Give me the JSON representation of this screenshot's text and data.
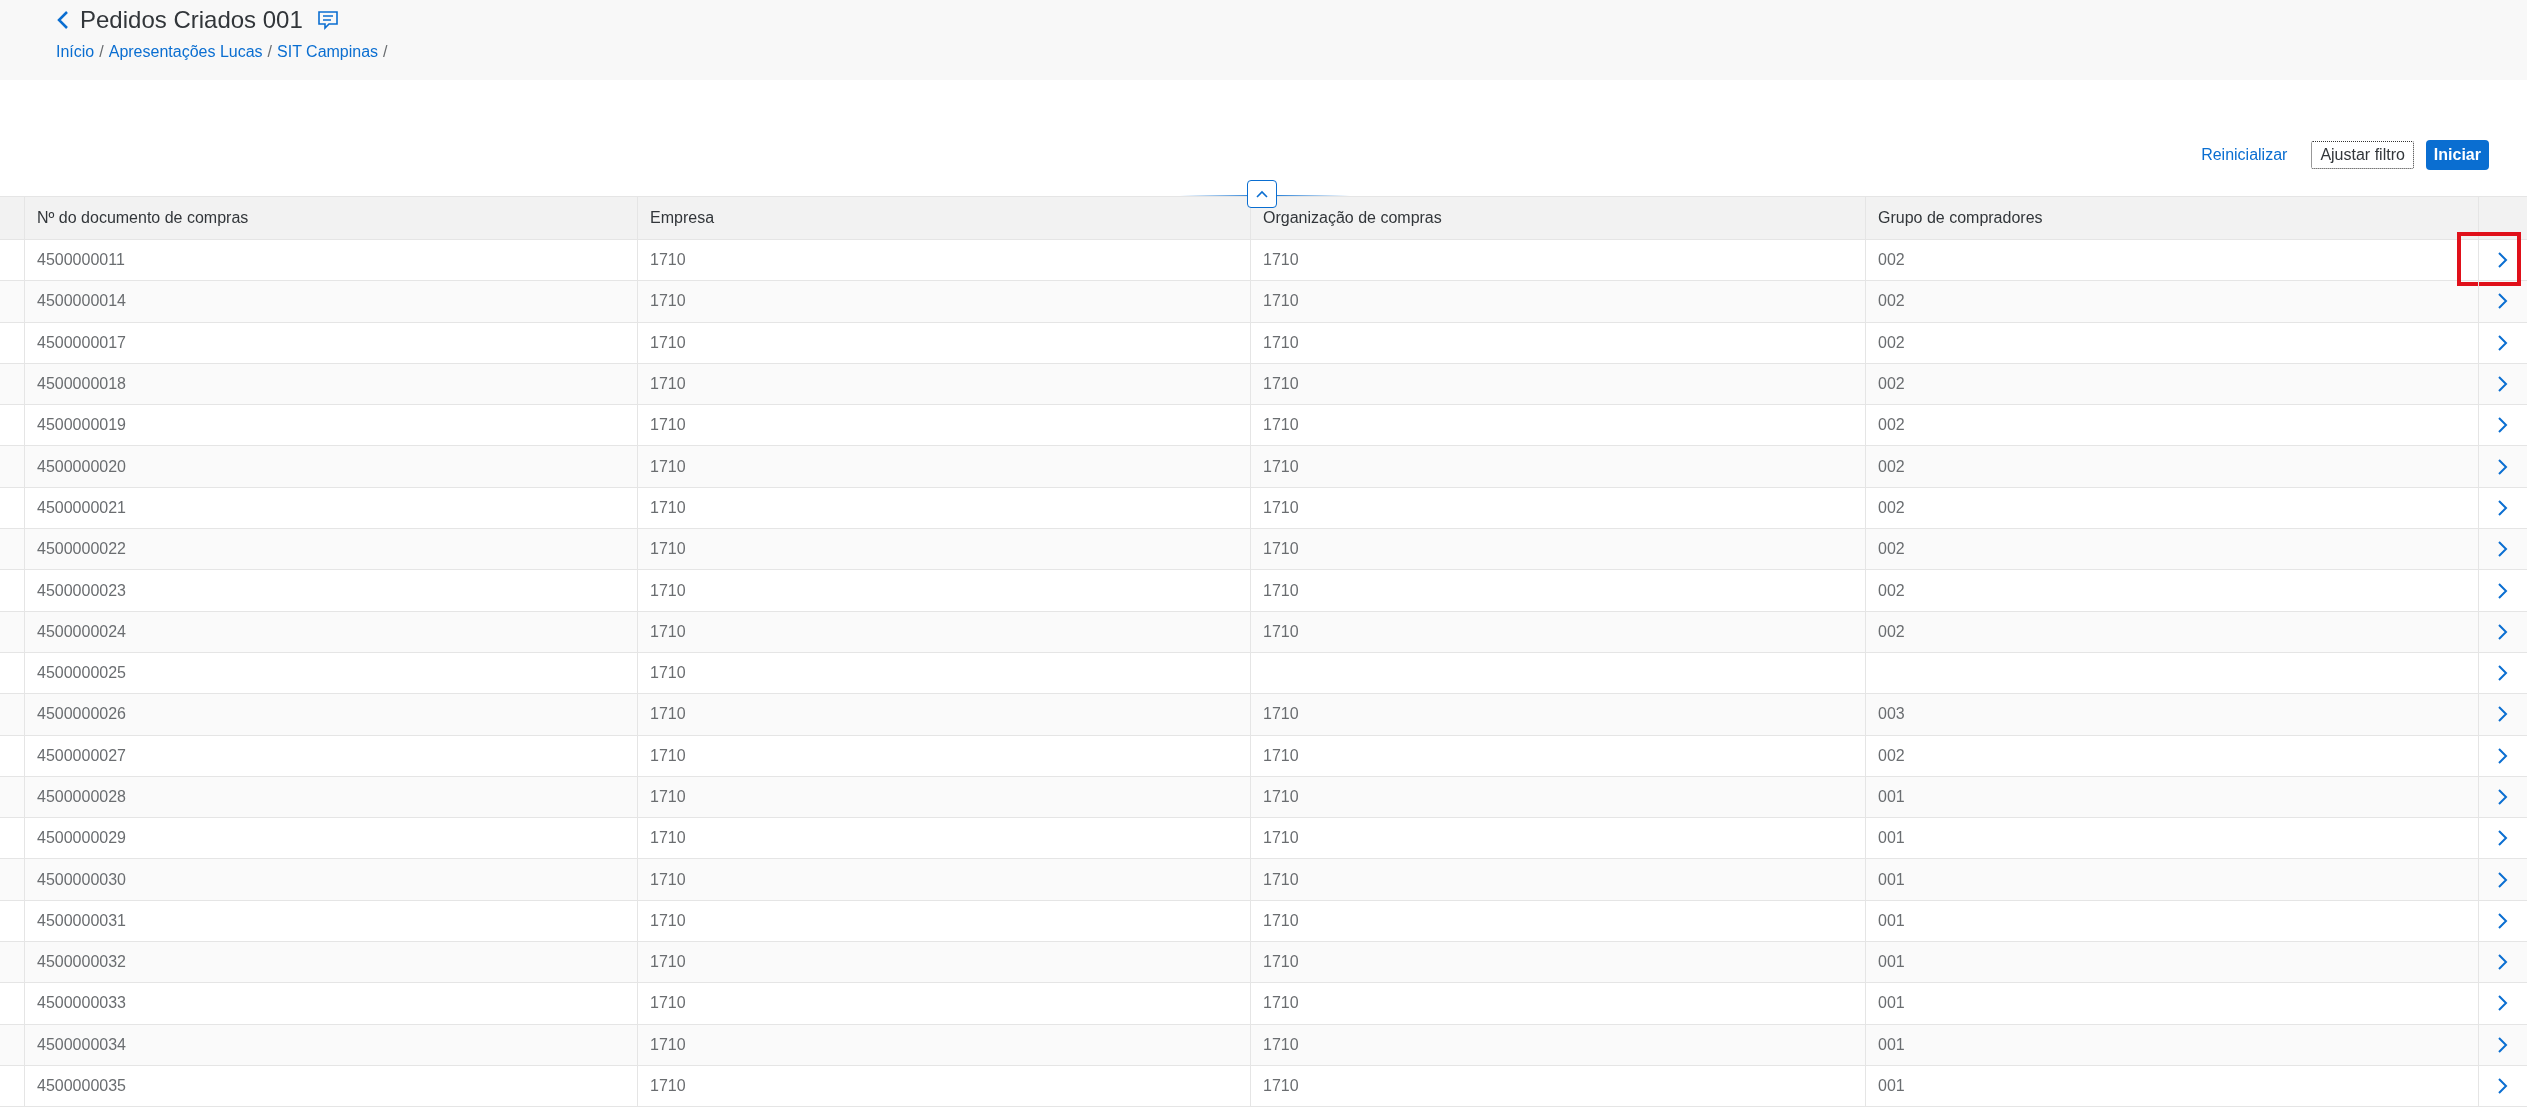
{
  "header": {
    "title": "Pedidos Criados 001",
    "breadcrumbs": [
      {
        "label": "Início",
        "separator": "/"
      },
      {
        "label": "Apresentações Lucas",
        "separator": "/"
      },
      {
        "label": "SIT Campinas",
        "separator": "/"
      }
    ]
  },
  "filter_bar": {
    "buttons": [
      {
        "label": "Reinicializar",
        "kind": "link"
      },
      {
        "label": "Ajustar filtro",
        "kind": "outline"
      },
      {
        "label": "Iniciar",
        "kind": "primary"
      }
    ]
  },
  "table": {
    "columns": [
      "Nº do documento de compras",
      "Empresa",
      "Organização de compras",
      "Grupo de compradores"
    ],
    "rows": [
      {
        "cells": [
          "4500000011",
          "1710",
          "1710",
          "002"
        ],
        "highlighted": true
      },
      {
        "cells": [
          "4500000014",
          "1710",
          "1710",
          "002"
        ],
        "highlighted": false
      },
      {
        "cells": [
          "4500000017",
          "1710",
          "1710",
          "002"
        ],
        "highlighted": false
      },
      {
        "cells": [
          "4500000018",
          "1710",
          "1710",
          "002"
        ],
        "highlighted": false
      },
      {
        "cells": [
          "4500000019",
          "1710",
          "1710",
          "002"
        ],
        "highlighted": false
      },
      {
        "cells": [
          "4500000020",
          "1710",
          "1710",
          "002"
        ],
        "highlighted": false
      },
      {
        "cells": [
          "4500000021",
          "1710",
          "1710",
          "002"
        ],
        "highlighted": false
      },
      {
        "cells": [
          "4500000022",
          "1710",
          "1710",
          "002"
        ],
        "highlighted": false
      },
      {
        "cells": [
          "4500000023",
          "1710",
          "1710",
          "002"
        ],
        "highlighted": false
      },
      {
        "cells": [
          "4500000024",
          "1710",
          "1710",
          "002"
        ],
        "highlighted": false
      },
      {
        "cells": [
          "4500000025",
          "1710",
          "",
          ""
        ],
        "highlighted": false
      },
      {
        "cells": [
          "4500000026",
          "1710",
          "1710",
          "003"
        ],
        "highlighted": false
      },
      {
        "cells": [
          "4500000027",
          "1710",
          "1710",
          "002"
        ],
        "highlighted": false
      },
      {
        "cells": [
          "4500000028",
          "1710",
          "1710",
          "001"
        ],
        "highlighted": false
      },
      {
        "cells": [
          "4500000029",
          "1710",
          "1710",
          "001"
        ],
        "highlighted": false
      },
      {
        "cells": [
          "4500000030",
          "1710",
          "1710",
          "001"
        ],
        "highlighted": false
      },
      {
        "cells": [
          "4500000031",
          "1710",
          "1710",
          "001"
        ],
        "highlighted": false
      },
      {
        "cells": [
          "4500000032",
          "1710",
          "1710",
          "001"
        ],
        "highlighted": false
      },
      {
        "cells": [
          "4500000033",
          "1710",
          "1710",
          "001"
        ],
        "highlighted": false
      },
      {
        "cells": [
          "4500000034",
          "1710",
          "1710",
          "001"
        ],
        "highlighted": false
      },
      {
        "cells": [
          "4500000035",
          "1710",
          "1710",
          "001"
        ],
        "highlighted": false
      }
    ]
  }
}
